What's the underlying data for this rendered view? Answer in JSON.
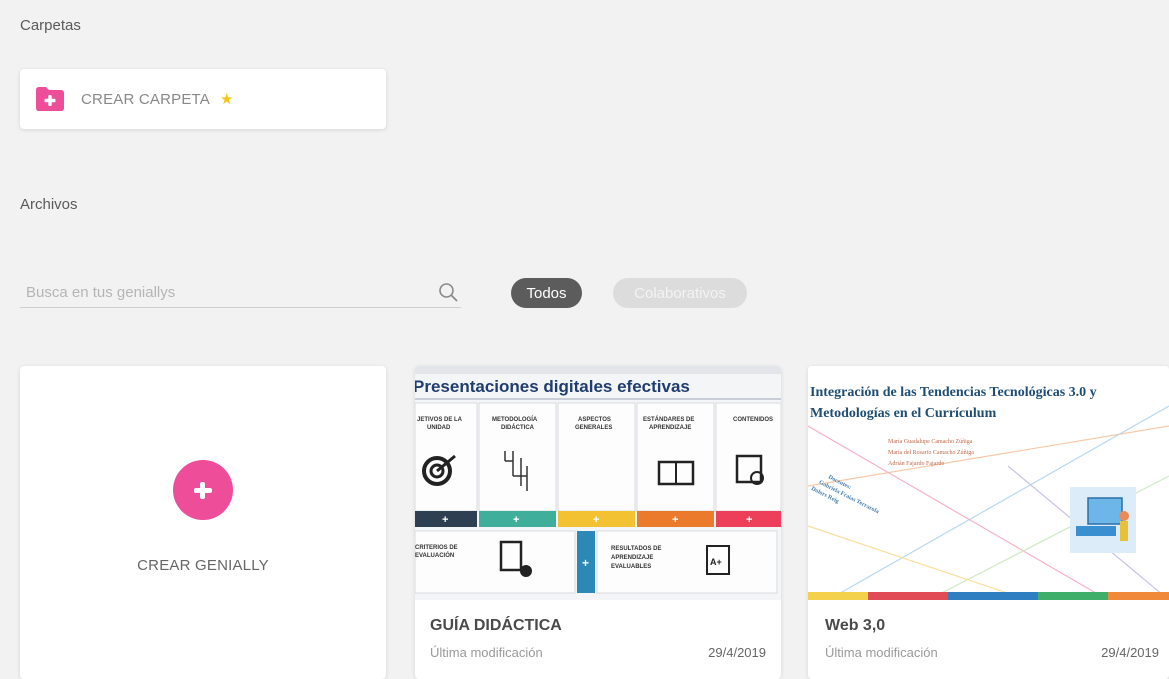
{
  "sections": {
    "folders_title": "Carpetas",
    "files_title": "Archivos"
  },
  "folder_card": {
    "label": "CREAR CARPETA",
    "icon": "folder-plus-icon",
    "badge_icon": "star-icon"
  },
  "search": {
    "placeholder": "Busca en tus geniallys",
    "value": ""
  },
  "filters": {
    "all": "Todos",
    "collab": "Colaborativos",
    "active": "Todos"
  },
  "create_card": {
    "label": "CREAR GENIALLY"
  },
  "cards": [
    {
      "title": "GUÍA DIDÁCTICA",
      "meta": "Última modificación",
      "date": "29/4/2019",
      "thumb": {
        "heading": "Presentaciones digitales efectivas",
        "columns": [
          "JETIVOS DE LA UNIDAD",
          "METODOLOGÍA DIDÁCTICA",
          "ASPECTOS GENERALES",
          "ESTÁNDARES DE APRENDIZAJE",
          "CONTENIDOS"
        ],
        "bottom_left": "CRITERIOS DE EVALUACIÓN",
        "bottom_right": "RESULTADOS DE APRENDIZAJE EVALUABLES",
        "grade": "A+"
      }
    },
    {
      "title": "Web 3,0",
      "meta": "Última modificación",
      "date": "29/4/2019",
      "thumb": {
        "heading": "Integración de las Tendencias Tecnológicas 3.0 y Metodologías en el Currículum",
        "authors": [
          "María Guadalupe Camacho Zúñiga",
          "María del Rosario Camacho Zúñiga",
          "Adrián Fajardo Fajardo"
        ],
        "teachers_label": "Docentes:",
        "teachers": [
          "Gabriela Fraias Terrarola",
          "Dolors Reig"
        ]
      }
    }
  ],
  "colors": {
    "accent_pink": "#ee4d9a",
    "chip_active": "#5c5c5c",
    "chip_inactive": "#dcdcdc",
    "star": "#f5c518",
    "background": "#f2f2f2"
  }
}
